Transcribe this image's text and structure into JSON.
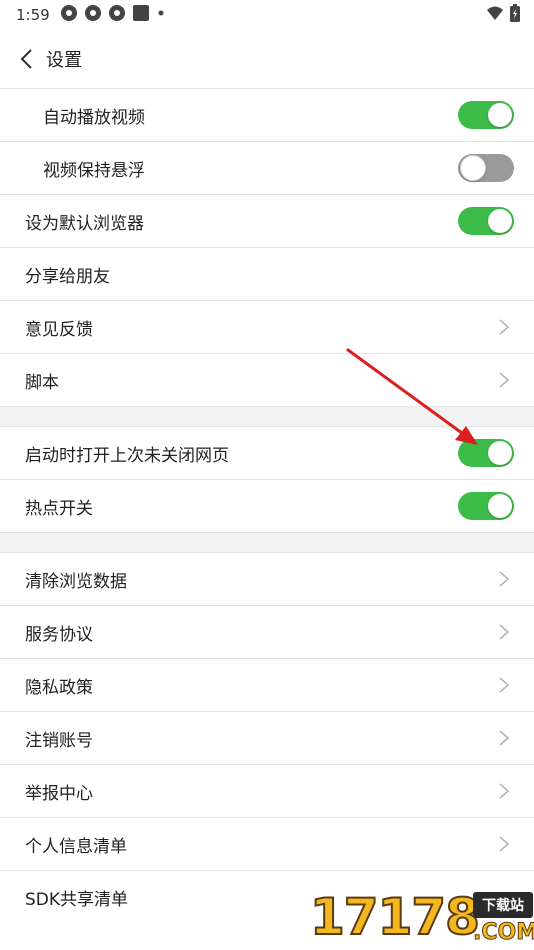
{
  "status_bar": {
    "time": "1:59",
    "icons": [
      "app-icon-1",
      "app-icon-2",
      "app-icon-3",
      "square-icon",
      "dot-icon",
      "wifi-icon",
      "battery-icon"
    ]
  },
  "header": {
    "title": "设置"
  },
  "settings": [
    {
      "label": "自动播放视频",
      "control": "toggle",
      "state": "on",
      "indent": true
    },
    {
      "label": "视频保持悬浮",
      "control": "toggle",
      "state": "off",
      "indent": true
    },
    {
      "label": "设为默认浏览器",
      "control": "toggle",
      "state": "on"
    },
    {
      "label": "分享给朋友",
      "control": "none"
    },
    {
      "label": "意见反馈",
      "control": "chevron"
    },
    {
      "label": "脚本",
      "control": "chevron"
    },
    {
      "label": "启动时打开上次未关闭网页",
      "control": "toggle",
      "state": "on"
    },
    {
      "label": "热点开关",
      "control": "toggle",
      "state": "on"
    },
    {
      "label": "清除浏览数据",
      "control": "chevron"
    },
    {
      "label": "服务协议",
      "control": "chevron"
    },
    {
      "label": "隐私政策",
      "control": "chevron"
    },
    {
      "label": "注销账号",
      "control": "chevron"
    },
    {
      "label": "举报中心",
      "control": "chevron"
    },
    {
      "label": "个人信息清单",
      "control": "chevron"
    },
    {
      "label": "SDK共享清单",
      "control": "none"
    }
  ],
  "watermark": {
    "digits": "17178",
    "badge": "下载站",
    "suffix": ".COM"
  },
  "colors": {
    "toggle_on": "#3dbb49",
    "toggle_off": "#9a9a9a",
    "annotation_arrow": "#d9201f",
    "watermark": "#f4b81e"
  }
}
